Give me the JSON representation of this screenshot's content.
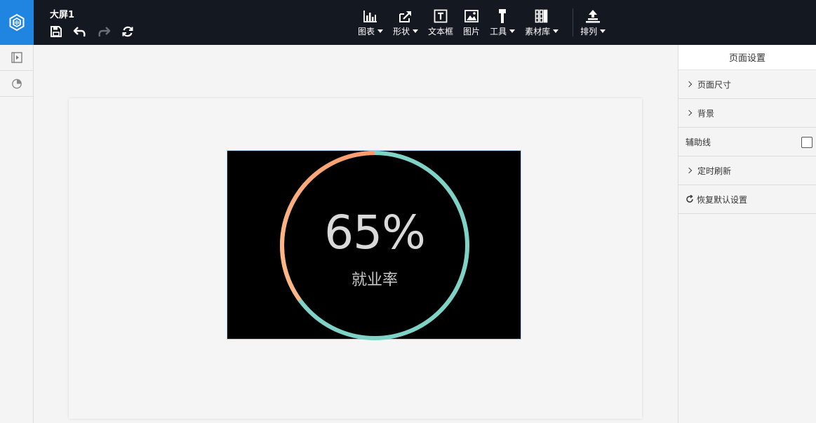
{
  "header": {
    "title": "大屏1",
    "quick_actions": [
      {
        "icon": "save-icon"
      },
      {
        "icon": "undo-icon"
      },
      {
        "icon": "redo-icon"
      },
      {
        "icon": "refresh-icon"
      }
    ],
    "tools": [
      {
        "label": "图表",
        "icon": "chart-icon",
        "has_dropdown": true
      },
      {
        "label": "形状",
        "icon": "shape-icon",
        "has_dropdown": true
      },
      {
        "label": "文本框",
        "icon": "textbox-icon",
        "has_dropdown": false
      },
      {
        "label": "图片",
        "icon": "image-icon",
        "has_dropdown": false
      },
      {
        "label": "工具",
        "icon": "tool-icon",
        "has_dropdown": true
      },
      {
        "label": "素材库",
        "icon": "library-icon",
        "has_dropdown": true
      },
      {
        "label": "排列",
        "icon": "arrange-icon",
        "has_dropdown": true
      }
    ]
  },
  "left_rail": [
    {
      "icon": "play-panel-icon"
    },
    {
      "icon": "pie-chart-icon"
    }
  ],
  "canvas": {
    "widget": {
      "value": 65,
      "value_text": "65%",
      "label": "就业率",
      "colors": {
        "background": "#000000",
        "track": "#7fd3c6",
        "progress_start": "#ffb889",
        "progress_end": "#ff9a6a",
        "text": "#d9d9d9"
      }
    }
  },
  "right_panel": {
    "title": "页面设置",
    "sections": [
      {
        "label": "页面尺寸",
        "type": "collapsible"
      },
      {
        "label": "背景",
        "type": "collapsible"
      },
      {
        "label": "辅助线",
        "type": "checkbox",
        "checked": false
      },
      {
        "label": "定时刷新",
        "type": "collapsible"
      },
      {
        "label": "恢复默认设置",
        "type": "action"
      }
    ]
  },
  "colors": {
    "topbar": "#141821",
    "logo": "#1f85e0",
    "workspace": "#f4f4f4"
  }
}
